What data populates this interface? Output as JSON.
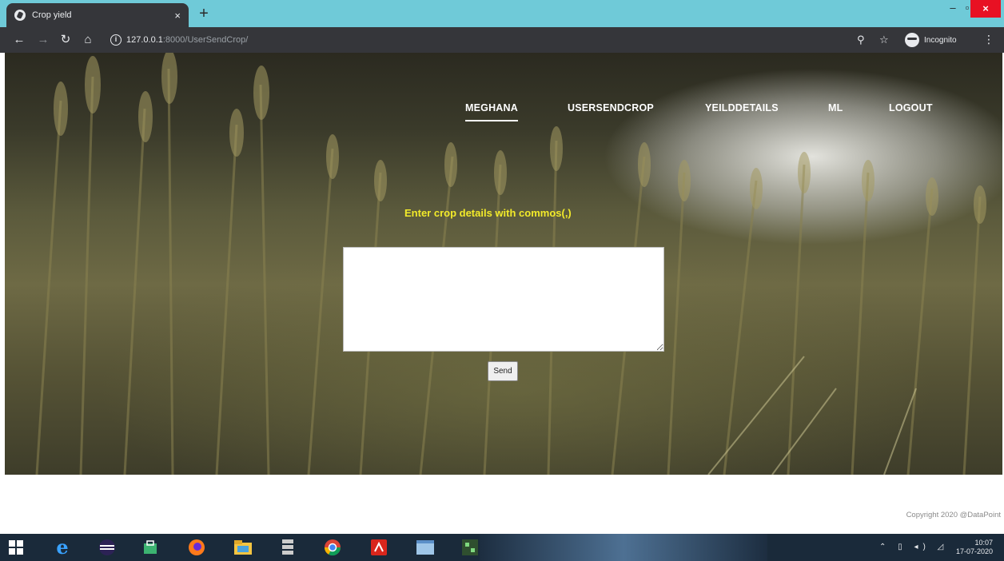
{
  "browser": {
    "tab_title": "Crop yield",
    "tab_close": "×",
    "new_tab": "+",
    "url_host": "127.0.0.1",
    "url_path": ":8000/UserSendCrop/",
    "profile_label": "Incognito",
    "window_minimize": "–",
    "window_maximize": "▫",
    "window_close": "×"
  },
  "nav": {
    "items": [
      {
        "label": "MEGHANA",
        "active": true
      },
      {
        "label": "USERSENDCROP",
        "active": false
      },
      {
        "label": "YEILDDETAILS",
        "active": false
      },
      {
        "label": "ML",
        "active": false
      },
      {
        "label": "LOGOUT",
        "active": false
      }
    ]
  },
  "form": {
    "label": "Enter crop details with commos(,)",
    "textarea_value": "",
    "send_label": "Send"
  },
  "footer": {
    "copyright": "Copyright 2020 @DataPoint"
  },
  "taskbar": {
    "time": "10:07",
    "date": "17-07-2020"
  },
  "colors": {
    "label_yellow": "#f2ea2a",
    "tabstrip": "#6fcad8",
    "chrome_dark": "#35363a",
    "taskbar": "#1a2a3a"
  }
}
